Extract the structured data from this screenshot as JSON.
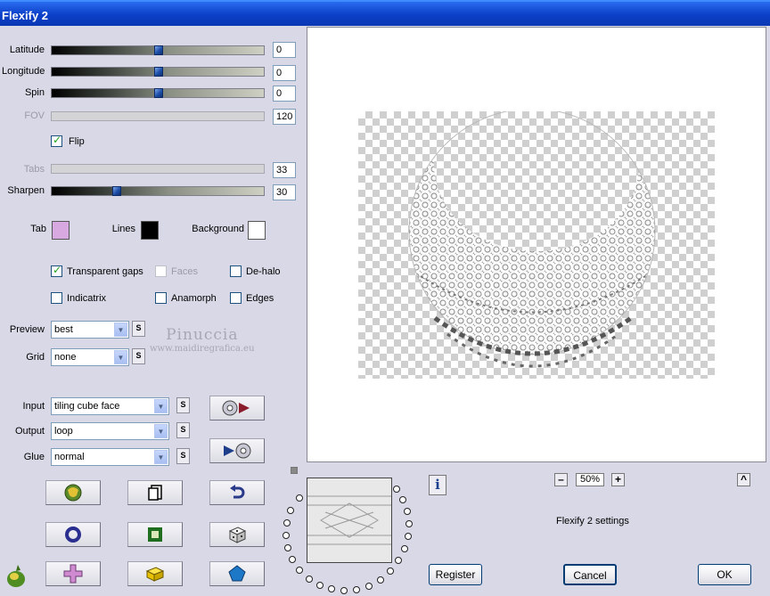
{
  "window": {
    "title": "Flexify 2"
  },
  "sliders": {
    "latitude": {
      "label": "Latitude",
      "value": "0",
      "level": 0.5,
      "enabled": true
    },
    "longitude": {
      "label": "Longitude",
      "value": "0",
      "level": 0.5,
      "enabled": true
    },
    "spin": {
      "label": "Spin",
      "value": "0",
      "level": 0.5,
      "enabled": true
    },
    "fov": {
      "label": "FOV",
      "value": "120",
      "enabled": false
    },
    "tabs": {
      "label": "Tabs",
      "value": "33",
      "enabled": false
    },
    "sharpen": {
      "label": "Sharpen",
      "value": "30",
      "level": 0.3,
      "enabled": true
    }
  },
  "flip": {
    "label": "Flip",
    "checked": true
  },
  "colors": {
    "tab": {
      "label": "Tab",
      "color": "#d8a8e0"
    },
    "lines": {
      "label": "Lines",
      "color": "#000000"
    },
    "background": {
      "label": "Background",
      "color": "#ffffff"
    }
  },
  "options": {
    "transparent_gaps": {
      "label": "Transparent gaps",
      "checked": true
    },
    "faces": {
      "label": "Faces",
      "checked": false,
      "enabled": false
    },
    "de_halo": {
      "label": "De-halo",
      "checked": false
    },
    "indicatrix": {
      "label": "Indicatrix",
      "checked": false
    },
    "anamorph": {
      "label": "Anamorph",
      "checked": false
    },
    "edges": {
      "label": "Edges",
      "checked": false
    }
  },
  "selects": {
    "preview": {
      "label": "Preview",
      "value": "best"
    },
    "grid": {
      "label": "Grid",
      "value": "none"
    },
    "input": {
      "label": "Input",
      "value": "tiling cube face"
    },
    "output": {
      "label": "Output",
      "value": "loop"
    },
    "glue": {
      "label": "Glue",
      "value": "normal"
    }
  },
  "s_button_label": "S",
  "watermark": {
    "line1": "Pinuccia",
    "line2": "www.maidiregrafica.eu"
  },
  "zoom": {
    "minus": "–",
    "value": "50%",
    "plus": "+"
  },
  "info_icon_label": "i",
  "collapse_label": "^",
  "settings_title": "Flexify 2 settings",
  "buttons": {
    "register": "Register",
    "cancel": "Cancel",
    "ok": "OK"
  },
  "icons": [
    "cd-to-flexify-icon",
    "flexify-to-cd-icon",
    "randomize-globe-icon",
    "copy-page-icon",
    "undo-arrow-icon",
    "ring-icon",
    "square-frame-icon",
    "dice-icon",
    "plus-shape-icon",
    "yellow-brick-icon",
    "pentagon-icon",
    "flexify-logo-icon"
  ]
}
